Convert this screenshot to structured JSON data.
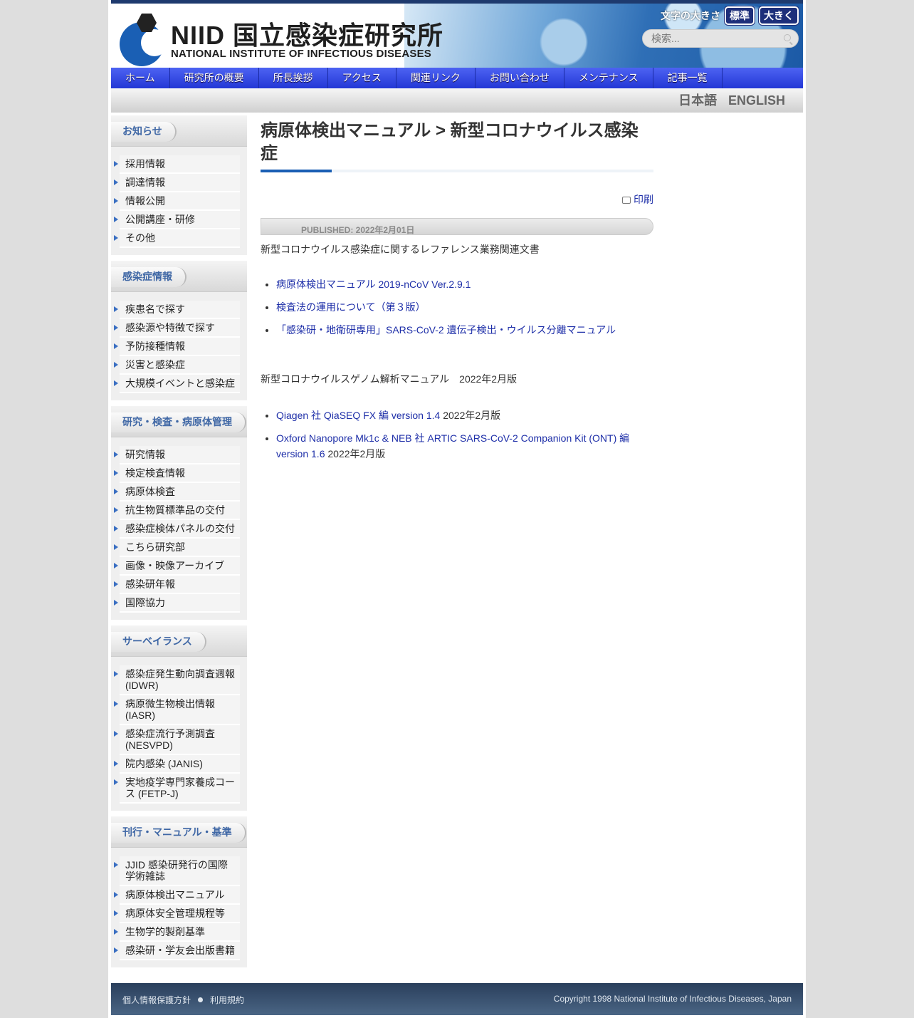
{
  "header": {
    "logo_name": "NIID 国立感染症研究所",
    "logo_sub": "NATIONAL INSTITUTE OF INFECTIOUS DISEASES",
    "font_size_label": "文字の大きさ",
    "font_std": "標準",
    "font_large": "大きく",
    "search_placeholder": "検索..."
  },
  "nav": [
    "ホーム",
    "研究所の概要",
    "所長挨拶",
    "アクセス",
    "関連リンク",
    "お問い合わせ",
    "メンテナンス",
    "記事一覧"
  ],
  "lang": {
    "ja": "日本語",
    "en": "ENGLISH"
  },
  "sidebar": [
    {
      "title": "お知らせ",
      "items": [
        "採用情報",
        "調達情報",
        "情報公開",
        "公開講座・研修",
        "その他"
      ]
    },
    {
      "title": "感染症情報",
      "items": [
        "疾患名で探す",
        "感染源や特徴で探す",
        "予防接種情報",
        "災害と感染症",
        "大規模イベントと感染症"
      ]
    },
    {
      "title": "研究・検査・病原体管理",
      "items": [
        "研究情報",
        "検定検査情報",
        "病原体検査",
        "抗生物質標準品の交付",
        "感染症検体パネルの交付",
        "こちら研究部",
        "画像・映像アーカイブ",
        "感染研年報",
        "国際協力"
      ]
    },
    {
      "title": "サーベイランス",
      "items": [
        "感染症発生動向調査週報 (IDWR)",
        "病原微生物検出情報 (IASR)",
        "感染症流行予測調査 (NESVPD)",
        "院内感染 (JANIS)",
        "実地疫学専門家養成コース (FETP-J)"
      ]
    },
    {
      "title": "刊行・マニュアル・基準",
      "items": [
        "JJID 感染研発行の国際学術雑誌",
        "病原体検出マニュアル",
        "病原体安全管理規程等",
        "生物学的製剤基準",
        "感染研・学友会出版書籍"
      ]
    }
  ],
  "main": {
    "title": "病原体検出マニュアル > 新型コロナウイルス感染症",
    "print": "印刷",
    "published": "PUBLISHED: 2022年2月01日",
    "intro": "新型コロナウイルス感染症に関するレファレンス業務関連文書",
    "links1": [
      {
        "text": "病原体検出マニュアル 2019-nCoV Ver.2.9.1",
        "suffix": ""
      },
      {
        "text": "検査法の運用について（第３版）",
        "suffix": ""
      },
      {
        "text": "「感染研・地衛研専用」SARS-CoV-2 遺伝子検出・ウイルス分離マニュアル",
        "suffix": ""
      }
    ],
    "genome_title": "新型コロナウイルスゲノム解析マニュアル　2022年2月版",
    "links2": [
      {
        "text": "Qiagen 社 QiaSEQ FX 編 version 1.4",
        "suffix": " 2022年2月版"
      },
      {
        "text": "Oxford Nanopore Mk1c & NEB 社 ARTIC SARS-CoV-2 Companion Kit (ONT) 編 version 1.6",
        "suffix": " 2022年2月版"
      }
    ]
  },
  "footer": {
    "privacy": "個人情報保護方針",
    "terms": "利用規約",
    "copyright": "Copyright 1998 National Institute of Infectious Diseases, Japan"
  }
}
